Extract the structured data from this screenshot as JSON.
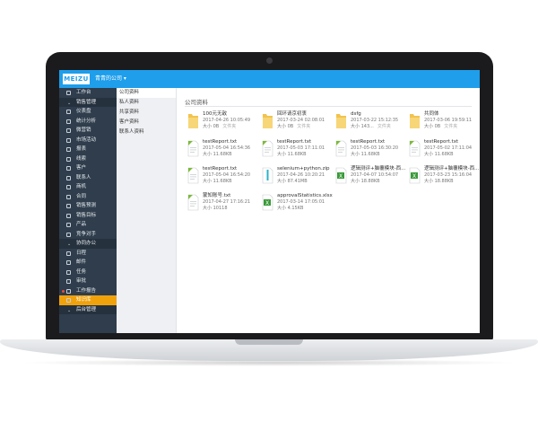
{
  "header": {
    "logo": "MEIZU",
    "company": "青青的公司 ▾",
    "accent": "#1e9eeb"
  },
  "sidebar": {
    "items": [
      {
        "label": "工作台",
        "type": "item"
      },
      {
        "label": "销售管理",
        "type": "section"
      },
      {
        "label": "仪表盘",
        "type": "item"
      },
      {
        "label": "统计分析",
        "type": "item"
      },
      {
        "label": "微营销",
        "type": "item"
      },
      {
        "label": "市场活动",
        "type": "item"
      },
      {
        "label": "报表",
        "type": "item"
      },
      {
        "label": "线索",
        "type": "item"
      },
      {
        "label": "客户",
        "type": "item"
      },
      {
        "label": "联系人",
        "type": "item"
      },
      {
        "label": "商机",
        "type": "item"
      },
      {
        "label": "合同",
        "type": "item"
      },
      {
        "label": "销售预测",
        "type": "item"
      },
      {
        "label": "销售目标",
        "type": "item"
      },
      {
        "label": "产品",
        "type": "item"
      },
      {
        "label": "竞争对手",
        "type": "item"
      },
      {
        "label": "协同办公",
        "type": "section"
      },
      {
        "label": "日程",
        "type": "item"
      },
      {
        "label": "邮件",
        "type": "item"
      },
      {
        "label": "任务",
        "type": "item"
      },
      {
        "label": "审批",
        "type": "item"
      },
      {
        "label": "工作报告",
        "type": "item",
        "badge": true
      },
      {
        "label": "知识库",
        "type": "item",
        "active": true
      },
      {
        "label": "后台管理",
        "type": "section"
      }
    ]
  },
  "subnav": {
    "items": [
      "公司资料",
      "私人资料",
      "共享资料",
      "客户资料",
      "联系人资料"
    ]
  },
  "main": {
    "title": "公司资料",
    "files": [
      {
        "name": "100元无敌",
        "date": "2017-04-26 10:05:49",
        "size": "大小 0B",
        "tag": "文件夹",
        "kind": "folder"
      },
      {
        "name": "回环请京初衷",
        "date": "2017-03-24 02:08:01",
        "size": "大小 0B",
        "tag": "文件夹",
        "kind": "folder"
      },
      {
        "name": "dsfg",
        "date": "2017-03-22 15:12:35",
        "size": "大小 143...",
        "tag": "文件夹",
        "kind": "folder"
      },
      {
        "name": "共同体",
        "date": "2017-03-06 19:59:11",
        "size": "大小 0B",
        "tag": "文件夹",
        "kind": "folder"
      },
      {
        "name": "testReport.txt",
        "date": "2017-05-04 16:54:36",
        "size": "大小 11.68KB",
        "tag": "",
        "kind": "txt"
      },
      {
        "name": "testReport.txt",
        "date": "2017-05-03 17:11:01",
        "size": "大小 11.68KB",
        "tag": "",
        "kind": "txt"
      },
      {
        "name": "testReport.txt",
        "date": "2017-05-03 16:30:20",
        "size": "大小 11.68KB",
        "tag": "",
        "kind": "txt"
      },
      {
        "name": "testReport.txt",
        "date": "2017-05-02 17:11:04",
        "size": "大小 11.68KB",
        "tag": "",
        "kind": "txt"
      },
      {
        "name": "testReport.txt",
        "date": "2017-05-04 16:54:20",
        "size": "大小 11.68KB",
        "tag": "",
        "kind": "txt"
      },
      {
        "name": "selenium+python.zip",
        "date": "2017-04-26 10:20:21",
        "size": "大小 87.41MB",
        "tag": "",
        "kind": "zip"
      },
      {
        "name": "逻辑测评+脑覆模块-西...",
        "date": "2017-04-07 10:54:07",
        "size": "大小 18.88KB",
        "tag": "",
        "kind": "xls"
      },
      {
        "name": "逻辑测评+脑覆模块-西...",
        "date": "2017-03-23 15:16:04",
        "size": "大小 18.88KB",
        "tag": "",
        "kind": "xls"
      },
      {
        "name": "蒙知账号.txt",
        "date": "2017-04-27 17:16:21",
        "size": "大小 10118",
        "tag": "",
        "kind": "txt"
      },
      {
        "name": "approvalStatistics.xlsx",
        "date": "2017-03-14 17:05:01",
        "size": "大小 4.15KB",
        "tag": "",
        "kind": "xls"
      }
    ]
  }
}
